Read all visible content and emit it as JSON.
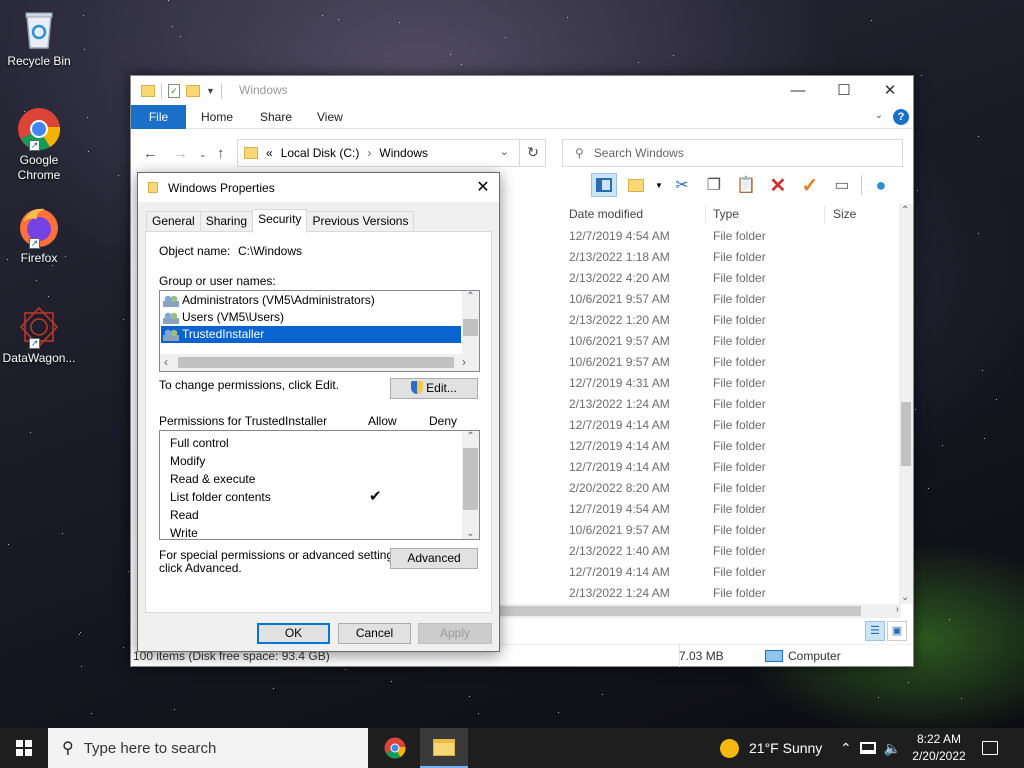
{
  "desktop": {
    "icons": [
      {
        "label": "Recycle Bin"
      },
      {
        "label": "Google Chrome"
      },
      {
        "label": "Firefox"
      },
      {
        "label": "DataWagon..."
      }
    ]
  },
  "explorer": {
    "title": "Windows",
    "ribbon_tabs": [
      "File",
      "Home",
      "Share",
      "View"
    ],
    "address": {
      "prefix": "«",
      "crumbs": [
        "Local Disk (C:)",
        "Windows"
      ]
    },
    "search_placeholder": "Search Windows",
    "columns": [
      "Date modified",
      "Type",
      "Size"
    ],
    "rows": [
      {
        "date": "12/7/2019 4:54 AM",
        "type": "File folder"
      },
      {
        "date": "2/13/2022 1:18 AM",
        "type": "File folder"
      },
      {
        "date": "2/13/2022 4:20 AM",
        "type": "File folder"
      },
      {
        "date": "10/6/2021 9:57 AM",
        "type": "File folder"
      },
      {
        "date": "2/13/2022 1:20 AM",
        "type": "File folder"
      },
      {
        "date": "10/6/2021 9:57 AM",
        "type": "File folder"
      },
      {
        "date": "10/6/2021 9:57 AM",
        "type": "File folder"
      },
      {
        "date": "12/7/2019 4:31 AM",
        "type": "File folder"
      },
      {
        "date": "2/13/2022 1:24 AM",
        "type": "File folder"
      },
      {
        "date": "12/7/2019 4:14 AM",
        "type": "File folder"
      },
      {
        "date": "12/7/2019 4:14 AM",
        "type": "File folder"
      },
      {
        "date": "12/7/2019 4:14 AM",
        "type": "File folder"
      },
      {
        "date": "2/20/2022 8:20 AM",
        "type": "File folder"
      },
      {
        "date": "12/7/2019 4:54 AM",
        "type": "File folder"
      },
      {
        "date": "10/6/2021 9:57 AM",
        "type": "File folder"
      },
      {
        "date": "2/13/2022 1:40 AM",
        "type": "File folder"
      },
      {
        "date": "12/7/2019 4:14 AM",
        "type": "File folder"
      },
      {
        "date": "2/13/2022 1:24 AM",
        "type": "File folder"
      }
    ],
    "status": {
      "items": "100 items (Disk free space: 93.4 GB)",
      "size": "7.03 MB",
      "location": "Computer"
    }
  },
  "dialog": {
    "title": "Windows Properties",
    "tabs": [
      "General",
      "Sharing",
      "Security",
      "Previous Versions"
    ],
    "active_tab": "Security",
    "object_label": "Object name:",
    "object_value": "C:\\Windows",
    "groups_label": "Group or user names:",
    "groups": [
      {
        "name": "Administrators (VM5\\Administrators)",
        "selected": false
      },
      {
        "name": "Users (VM5\\Users)",
        "selected": false
      },
      {
        "name": "TrustedInstaller",
        "selected": true
      }
    ],
    "change_text": "To change permissions, click Edit.",
    "edit_button": "Edit...",
    "perm_label": "Permissions for TrustedInstaller",
    "allow_header": "Allow",
    "deny_header": "Deny",
    "permissions": [
      {
        "name": "Full control",
        "allow": false,
        "deny": false
      },
      {
        "name": "Modify",
        "allow": false,
        "deny": false
      },
      {
        "name": "Read & execute",
        "allow": false,
        "deny": false
      },
      {
        "name": "List folder contents",
        "allow": true,
        "deny": false
      },
      {
        "name": "Read",
        "allow": false,
        "deny": false
      },
      {
        "name": "Write",
        "allow": false,
        "deny": false
      }
    ],
    "special_text_1": "For special permissions or advanced settings,",
    "special_text_2": "click Advanced.",
    "advanced_button": "Advanced",
    "ok_button": "OK",
    "cancel_button": "Cancel",
    "apply_button": "Apply"
  },
  "taskbar": {
    "search_placeholder": "Type here to search",
    "weather": "21°F  Sunny",
    "time": "8:22 AM",
    "date": "2/20/2022"
  },
  "colors": {
    "accent": "#0078d7",
    "selection": "#0a64d0",
    "taskbar": "#1e1e1e"
  }
}
